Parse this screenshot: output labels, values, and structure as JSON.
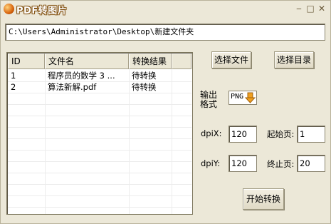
{
  "app": {
    "title": "PDF转图片"
  },
  "window_controls": {
    "minimize": "‒",
    "maximize": "□",
    "close": "✕"
  },
  "path": {
    "value": "C:\\Users\\Administrator\\Desktop\\新建文件夹"
  },
  "file_list": {
    "columns": [
      "ID",
      "文件名",
      "转换结果"
    ],
    "rows": [
      {
        "id": "1",
        "name": "程序员的数学 3 ...",
        "status": "待转换"
      },
      {
        "id": "2",
        "name": "算法新解.pdf",
        "status": "待转换"
      }
    ]
  },
  "buttons": {
    "select_file": "选择文件",
    "select_dir": "选择目录",
    "start": "开始转换"
  },
  "format": {
    "label_line1": "输出",
    "label_line2": "格式",
    "value": "PNG"
  },
  "dpi": {
    "x_label": "dpiX:",
    "x_value": "120",
    "y_label": "dpiY:",
    "y_value": "120"
  },
  "pages": {
    "start_label": "起始页:",
    "start_value": "1",
    "end_label": "终止页:",
    "end_value": "20"
  },
  "colors": {
    "accent": "#f0a020",
    "window_bg": "#ece8d8"
  }
}
